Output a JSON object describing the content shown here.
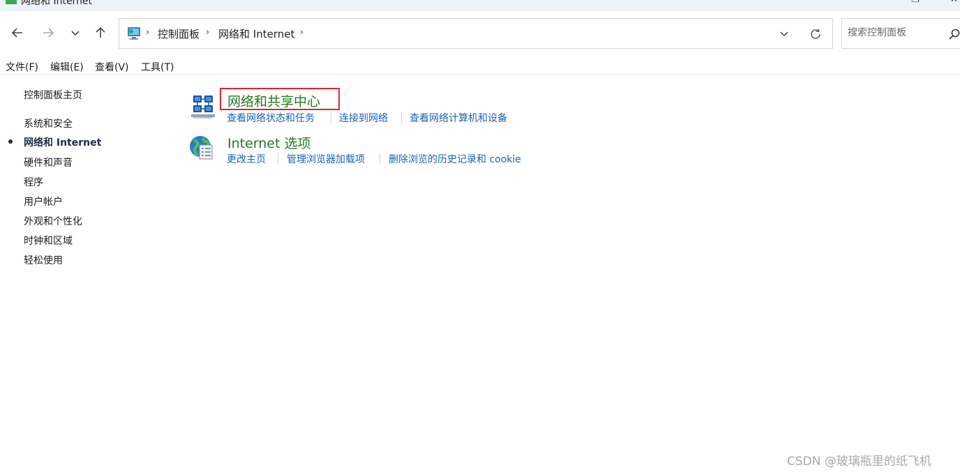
{
  "window": {
    "title": "网络和 Internet",
    "icon": "network-folder-icon",
    "controls": [
      "restore-icon",
      "close-icon"
    ]
  },
  "nav": {
    "back_icon": "arrow-left-icon",
    "forward_icon": "arrow-right-icon",
    "recent_icon": "chevron-down-icon",
    "up_icon": "arrow-up-icon"
  },
  "address": {
    "icon": "control-panel-icon",
    "breadcrumbs": [
      "控制面板",
      "网络和 Internet"
    ],
    "dropdown_icon": "chevron-down-icon",
    "refresh_icon": "refresh-icon"
  },
  "search": {
    "placeholder": "搜索控制面板",
    "icon": "search-icon"
  },
  "menubar": {
    "items": [
      "文件(F)",
      "编辑(E)",
      "查看(V)",
      "工具(T)"
    ]
  },
  "sidebar": {
    "home": "控制面板主页",
    "items": [
      "系统和安全",
      "网络和 Internet",
      "硬件和声音",
      "程序",
      "用户帐户",
      "外观和个性化",
      "时钟和区域",
      "轻松使用"
    ],
    "active_index": 1
  },
  "categories": [
    {
      "title": "网络和共享中心",
      "icon": "network-sharing-center-icon",
      "highlighted": true,
      "tasks": [
        "查看网络状态和任务",
        "连接到网络",
        "查看网络计算机和设备"
      ]
    },
    {
      "title": "Internet 选项",
      "icon": "internet-options-globe-icon",
      "highlighted": false,
      "tasks": [
        "更改主页",
        "管理浏览器加载项",
        "删除浏览的历史记录和 cookie"
      ]
    }
  ],
  "colors": {
    "category_title": "#1e7b1e",
    "task_link": "#1a62b8",
    "highlight_border": "#e3232c",
    "titlebar_bg": "#eef3fa"
  },
  "watermark": "CSDN @玻璃瓶里的纸飞机"
}
